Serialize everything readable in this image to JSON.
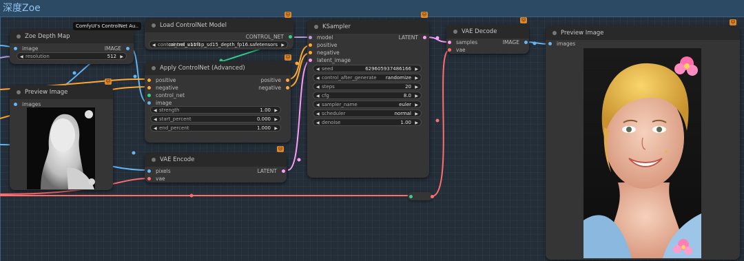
{
  "group": {
    "title": "深度Zoe"
  },
  "colors": {
    "image": "#64b5f6",
    "control": "#33d08d",
    "conditioning": "#ffa931",
    "latent": "#ff9cf9",
    "vae": "#ff6e6e",
    "model": "#b39ddb"
  },
  "tooltip": {
    "text": "ComfyUI's ControlNet Au.."
  },
  "nodes": {
    "zoe": {
      "title": "Zoe Depth Map",
      "in_image": "image",
      "out_image": "IMAGE",
      "w_resolution_label": "resolution",
      "w_resolution_value": "512"
    },
    "preview_left": {
      "title": "Preview Image",
      "in_images": "images"
    },
    "load_cn": {
      "title": "Load ControlNet Model",
      "out_control": "CONTROL_NET",
      "w_name_label": "control_net_name",
      "w_name_value": "control_v11f1p_sd15_depth_fp16.safetensors"
    },
    "apply_cn": {
      "title": "Apply ControlNet (Advanced)",
      "in_positive": "positive",
      "in_negative": "negative",
      "in_control_net": "control_net",
      "in_image": "image",
      "out_positive": "positive",
      "out_negative": "negative",
      "w_strength_label": "strength",
      "w_strength_value": "1.00",
      "w_start_label": "start_percent",
      "w_start_value": "0.000",
      "w_end_label": "end_percent",
      "w_end_value": "1.000"
    },
    "vae_encode": {
      "title": "VAE Encode",
      "in_pixels": "pixels",
      "in_vae": "vae",
      "out_latent": "LATENT"
    },
    "ksampler": {
      "title": "KSampler",
      "in_model": "model",
      "in_positive": "positive",
      "in_negative": "negative",
      "in_latent": "latent_image",
      "out_latent": "LATENT",
      "widgets": [
        {
          "label": "seed",
          "value": "629605937486166"
        },
        {
          "label": "control_after_generate",
          "value": "randomize"
        },
        {
          "label": "steps",
          "value": "20"
        },
        {
          "label": "cfg",
          "value": "8.0"
        },
        {
          "label": "sampler_name",
          "value": "euler"
        },
        {
          "label": "scheduler",
          "value": "normal"
        },
        {
          "label": "denoise",
          "value": "1.00"
        }
      ]
    },
    "vae_decode": {
      "title": "VAE Decode",
      "in_samples": "samples",
      "in_vae": "vae",
      "out_image": "IMAGE"
    },
    "preview_right": {
      "title": "Preview Image",
      "in_images": "images"
    }
  }
}
